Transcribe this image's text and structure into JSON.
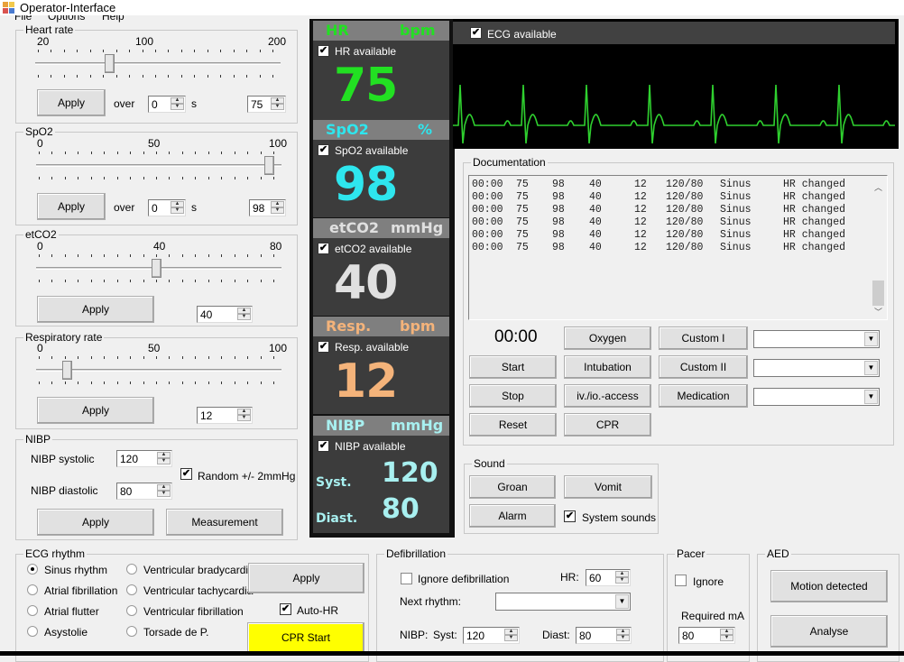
{
  "window": {
    "title": "Operator-Interface"
  },
  "menu": {
    "items": [
      "File",
      "Options",
      "Help"
    ]
  },
  "heart_rate": {
    "group_label": "Heart rate",
    "scale_labels": [
      "20",
      "100",
      "200"
    ],
    "slider_min": 20,
    "slider_max": 200,
    "slider_value": 75,
    "apply_label": "Apply",
    "over_label": "over",
    "over_value": "0",
    "seconds_label": "s",
    "value": "75"
  },
  "spo2": {
    "group_label": "SpO2",
    "scale_labels": [
      "0",
      "50",
      "100"
    ],
    "slider_min": 0,
    "slider_max": 100,
    "slider_value": 98,
    "apply_label": "Apply",
    "over_label": "over",
    "over_value": "0",
    "seconds_label": "s",
    "value": "98"
  },
  "etco2": {
    "group_label": "etCO2",
    "scale_labels": [
      "0",
      "40",
      "80"
    ],
    "slider_min": 0,
    "slider_max": 80,
    "slider_value": 40,
    "apply_label": "Apply",
    "value": "40"
  },
  "resp": {
    "group_label": "Respiratory rate",
    "scale_labels": [
      "0",
      "50",
      "100"
    ],
    "slider_min": 0,
    "slider_max": 100,
    "slider_value": 12,
    "apply_label": "Apply",
    "value": "12"
  },
  "nibp": {
    "group_label": "NIBP",
    "systolic_label": "NIBP systolic",
    "systolic_value": "120",
    "diastolic_label": "NIBP diastolic",
    "diastolic_value": "80",
    "random_label": "Random +/- 2mmHg",
    "random_checked": true,
    "apply_label": "Apply",
    "measurement_label": "Measurement"
  },
  "monitor": {
    "hr": {
      "name": "HR",
      "unit": "bpm",
      "available_label": "HR available",
      "value": "75",
      "color": "#22e022"
    },
    "spo2": {
      "name": "SpO2",
      "unit": "%",
      "available_label": "SpO2 available",
      "value": "98",
      "color": "#2ee6ee"
    },
    "etco2": {
      "name": "etCO2",
      "unit": "mmHg",
      "available_label": "etCO2 available",
      "value": "40",
      "color": "#e0e0e0"
    },
    "resp": {
      "name": "Resp.",
      "unit": "bpm",
      "available_label": "Resp. available",
      "value": "12",
      "color": "#f4b37a"
    },
    "nibp": {
      "name": "NIBP",
      "unit": "mmHg",
      "available_label": "NIBP available",
      "syst_label": "Syst.",
      "syst_value": "120",
      "diast_label": "Diast.",
      "diast_value": "80",
      "color": "#a8f0f0"
    }
  },
  "ecg": {
    "available_label": "ECG available",
    "trace_color": "#2fd02f"
  },
  "documentation": {
    "group_label": "Documentation",
    "rows": [
      [
        "00:00",
        "75",
        "98",
        "40",
        "12",
        "120/80",
        "Sinus",
        "HR changed"
      ],
      [
        "00:00",
        "75",
        "98",
        "40",
        "12",
        "120/80",
        "Sinus",
        "HR changed"
      ],
      [
        "00:00",
        "75",
        "98",
        "40",
        "12",
        "120/80",
        "Sinus",
        "HR changed"
      ],
      [
        "00:00",
        "75",
        "98",
        "40",
        "12",
        "120/80",
        "Sinus",
        "HR changed"
      ],
      [
        "00:00",
        "75",
        "98",
        "40",
        "12",
        "120/80",
        "Sinus",
        "HR changed"
      ],
      [
        "00:00",
        "75",
        "98",
        "40",
        "12",
        "120/80",
        "Sinus",
        "HR changed"
      ]
    ],
    "timer": "00:00",
    "buttons": {
      "start": "Start",
      "stop": "Stop",
      "reset": "Reset",
      "oxygen": "Oxygen",
      "intubation": "Intubation",
      "access": "iv./io.-access",
      "cpr": "CPR",
      "custom1": "Custom I",
      "custom2": "Custom II",
      "medication": "Medication"
    },
    "custom1_value": "",
    "custom2_value": "",
    "medication_value": ""
  },
  "sound": {
    "group_label": "Sound",
    "groan": "Groan",
    "vomit": "Vomit",
    "alarm": "Alarm",
    "system_sounds_label": "System sounds",
    "system_sounds_checked": true
  },
  "ecg_rhythm": {
    "group_label": "ECG rhythm",
    "options": [
      "Sinus rhythm",
      "Atrial fibrillation",
      "Atrial flutter",
      "Asystolie",
      "Ventricular bradycardia",
      "Ventricular tachycardia",
      "Ventricular fibrillation",
      "Torsade de P."
    ],
    "selected": "Sinus rhythm",
    "apply_label": "Apply",
    "auto_hr_label": "Auto-HR",
    "auto_hr_checked": true,
    "cpr_start_label": "CPR Start",
    "cpr_color": "#ffff00"
  },
  "defibrillation": {
    "group_label": "Defibrillation",
    "ignore_label": "Ignore defibrillation",
    "ignore_checked": false,
    "hr_label": "HR:",
    "hr_value": "60",
    "next_rhythm_label": "Next rhythm:",
    "next_rhythm_value": "",
    "nibp_label": "NIBP:",
    "syst_label": "Syst:",
    "syst_value": "120",
    "diast_label": "Diast:",
    "diast_value": "80"
  },
  "pacer": {
    "group_label": "Pacer",
    "ignore_label": "Ignore",
    "ignore_checked": false,
    "required_label": "Required mA",
    "required_value": "80"
  },
  "aed": {
    "group_label": "AED",
    "motion_label": "Motion detected",
    "analyse_label": "Analyse"
  }
}
